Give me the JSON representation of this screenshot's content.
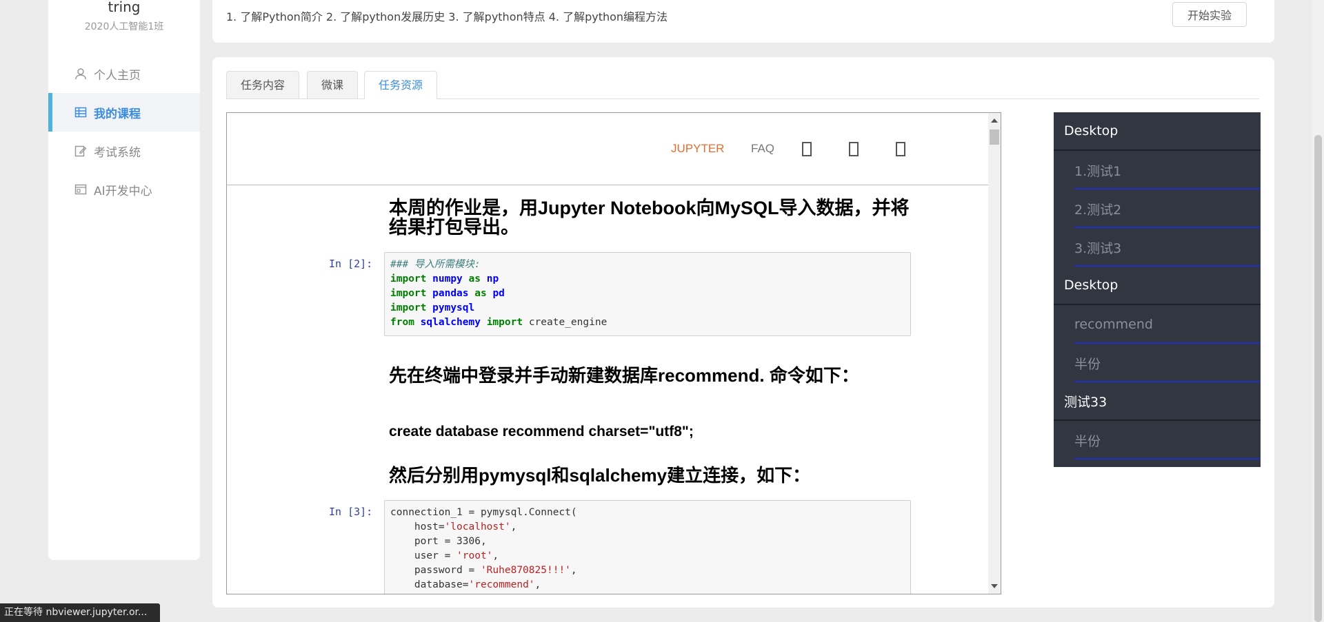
{
  "sidebar": {
    "user_name": "tring",
    "user_class": "2020人工智能1班",
    "items": [
      {
        "label": "个人主页",
        "icon": "user-icon"
      },
      {
        "label": "我的课程",
        "icon": "course-table-icon",
        "active": true
      },
      {
        "label": "考试系统",
        "icon": "edit-icon"
      },
      {
        "label": "AI开发中心",
        "icon": "dev-center-icon"
      }
    ]
  },
  "top": {
    "goals": "1. 了解Python简介 2. 了解python发展历史 3. 了解python特点 4. 了解python编程方法",
    "start_button": "开始实验"
  },
  "tabs": [
    {
      "label": "任务内容"
    },
    {
      "label": "微课"
    },
    {
      "label": "任务资源",
      "active": true
    }
  ],
  "notebook": {
    "header_links": [
      "JUPYTER",
      "FAQ"
    ],
    "title": "本周的作业是，用Jupyter Notebook向MySQL导入数据，并将结果打包导出。",
    "cell1_prompt": "In  [2]:",
    "cell1_code": [
      "### 导入所需模块:",
      "import numpy as np",
      "import pandas as pd",
      "import pymysql",
      "from sqlalchemy import create_engine"
    ],
    "heading2": "先在终端中登录并手动新建数据库recommend. 命令如下：",
    "sql_command": "create database recommend charset=\"utf8\";",
    "heading3": "然后分别用pymysql和sqlalchemy建立连接，如下：",
    "cell2_prompt": "In  [3]:",
    "cell2_code": [
      "connection_1 = pymysql.Connect(",
      "    host='localhost',",
      "    port = 3306,",
      "    user = 'root',",
      "    password = 'Ruhe870825!!!',",
      "    database='recommend',"
    ]
  },
  "tree": [
    {
      "type": "folder",
      "label": "Desktop"
    },
    {
      "type": "file",
      "label": "1.测试1"
    },
    {
      "type": "file",
      "label": "2.测试2"
    },
    {
      "type": "file",
      "label": "3.测试3"
    },
    {
      "type": "folder",
      "label": "Desktop"
    },
    {
      "type": "file",
      "label": "recommend"
    },
    {
      "type": "file",
      "label": "半份"
    },
    {
      "type": "folder",
      "label": "测试33"
    },
    {
      "type": "file",
      "label": "半份"
    }
  ],
  "status_bar": "正在等待 nbviewer.jupyter.or...",
  "colors": {
    "accent": "#3c8dde",
    "active_bar": "#4fb3d9",
    "tree_bg": "#323641",
    "jupyter_orange": "#e46e2e"
  }
}
